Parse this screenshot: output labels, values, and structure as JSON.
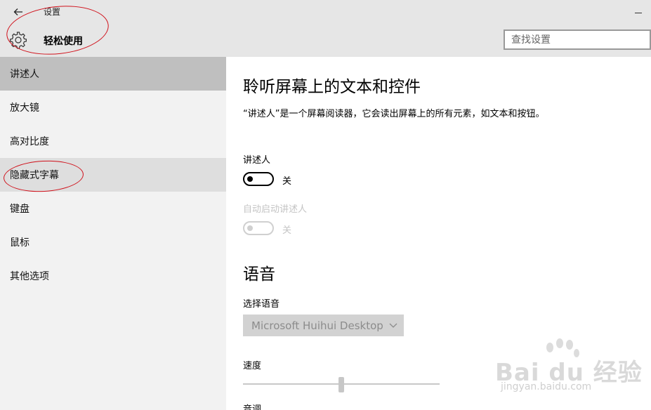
{
  "window": {
    "title": "设置",
    "category": "轻松使用"
  },
  "search": {
    "placeholder": "查找设置"
  },
  "sidebar": {
    "items": [
      {
        "label": "讲述人"
      },
      {
        "label": "放大镜"
      },
      {
        "label": "高对比度"
      },
      {
        "label": "隐藏式字幕"
      },
      {
        "label": "键盘"
      },
      {
        "label": "鼠标"
      },
      {
        "label": "其他选项"
      }
    ]
  },
  "main": {
    "heading": "聆听屏幕上的文本和控件",
    "description": "“讲述人”是一个屏幕阅读器，它会读出屏幕上的所有元素，如文本和按钮。",
    "narrator": {
      "label": "讲述人",
      "state": "关"
    },
    "auto_start": {
      "label": "自动启动讲述人",
      "state": "关"
    },
    "voice_section": "语音",
    "choose_voice": {
      "label": "选择语音",
      "value": "Microsoft Huihui Desktop"
    },
    "speed": {
      "label": "速度",
      "level_fraction": 0.5
    },
    "pitch": {
      "label": "音调"
    }
  },
  "watermark": {
    "main": "Bai du 经验",
    "sub": "jingyan.baidu.com"
  },
  "colors": {
    "header_bg": "#e6e6e6",
    "sidebar_bg": "#f2f2f2",
    "selected_bg": "#bfbfbf",
    "annotation": "#d0101a"
  }
}
